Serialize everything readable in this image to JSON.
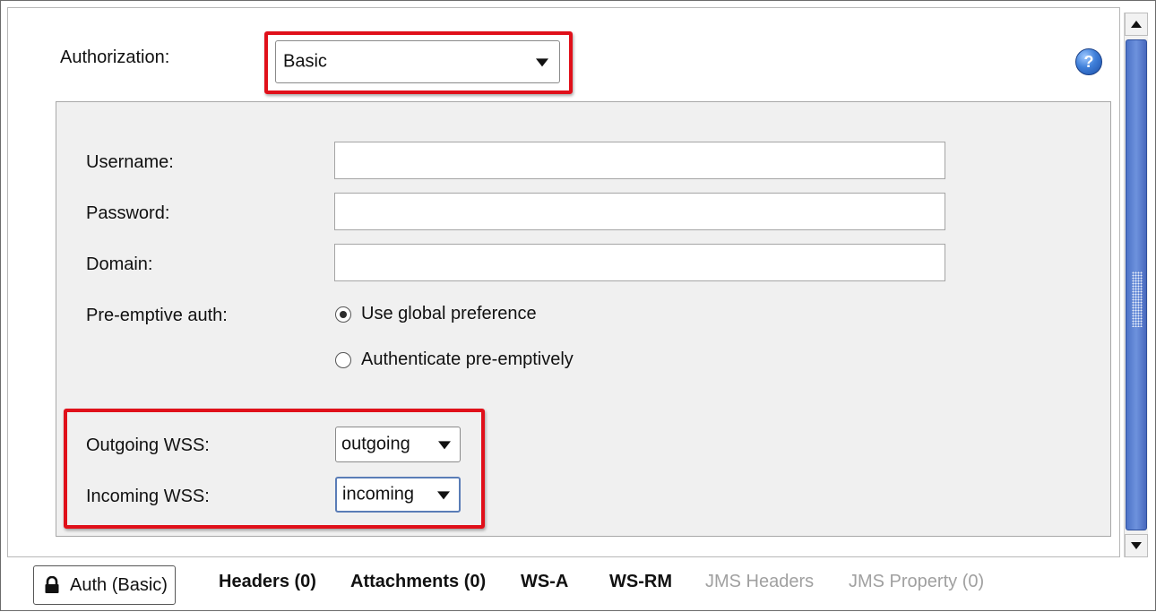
{
  "authorization": {
    "label": "Authorization:",
    "selected": "Basic"
  },
  "help_icon": "?",
  "fields": {
    "username_label": "Username:",
    "username_value": "",
    "password_label": "Password:",
    "password_value": "",
    "domain_label": "Domain:",
    "domain_value": ""
  },
  "preemptive": {
    "label": "Pre-emptive auth:",
    "options": [
      "Use global preference",
      "Authenticate pre-emptively"
    ],
    "selected_index": 0
  },
  "wss": {
    "outgoing_label": "Outgoing WSS:",
    "outgoing_value": "outgoing",
    "incoming_label": "Incoming WSS:",
    "incoming_value": "incoming"
  },
  "tabs": [
    {
      "label": "Auth (Basic)",
      "icon": "lock-icon",
      "state": "active"
    },
    {
      "label": "Headers (0)",
      "state": "normal"
    },
    {
      "label": "Attachments (0)",
      "state": "normal"
    },
    {
      "label": "WS-A",
      "state": "normal"
    },
    {
      "label": "WS-RM",
      "state": "normal"
    },
    {
      "label": "JMS Headers",
      "state": "disabled"
    },
    {
      "label": "JMS Property (0)",
      "state": "disabled"
    }
  ],
  "colors": {
    "highlight": "#e0101a",
    "scroll_thumb": "#5a80d0",
    "panel_bg": "#f0f0f0"
  }
}
